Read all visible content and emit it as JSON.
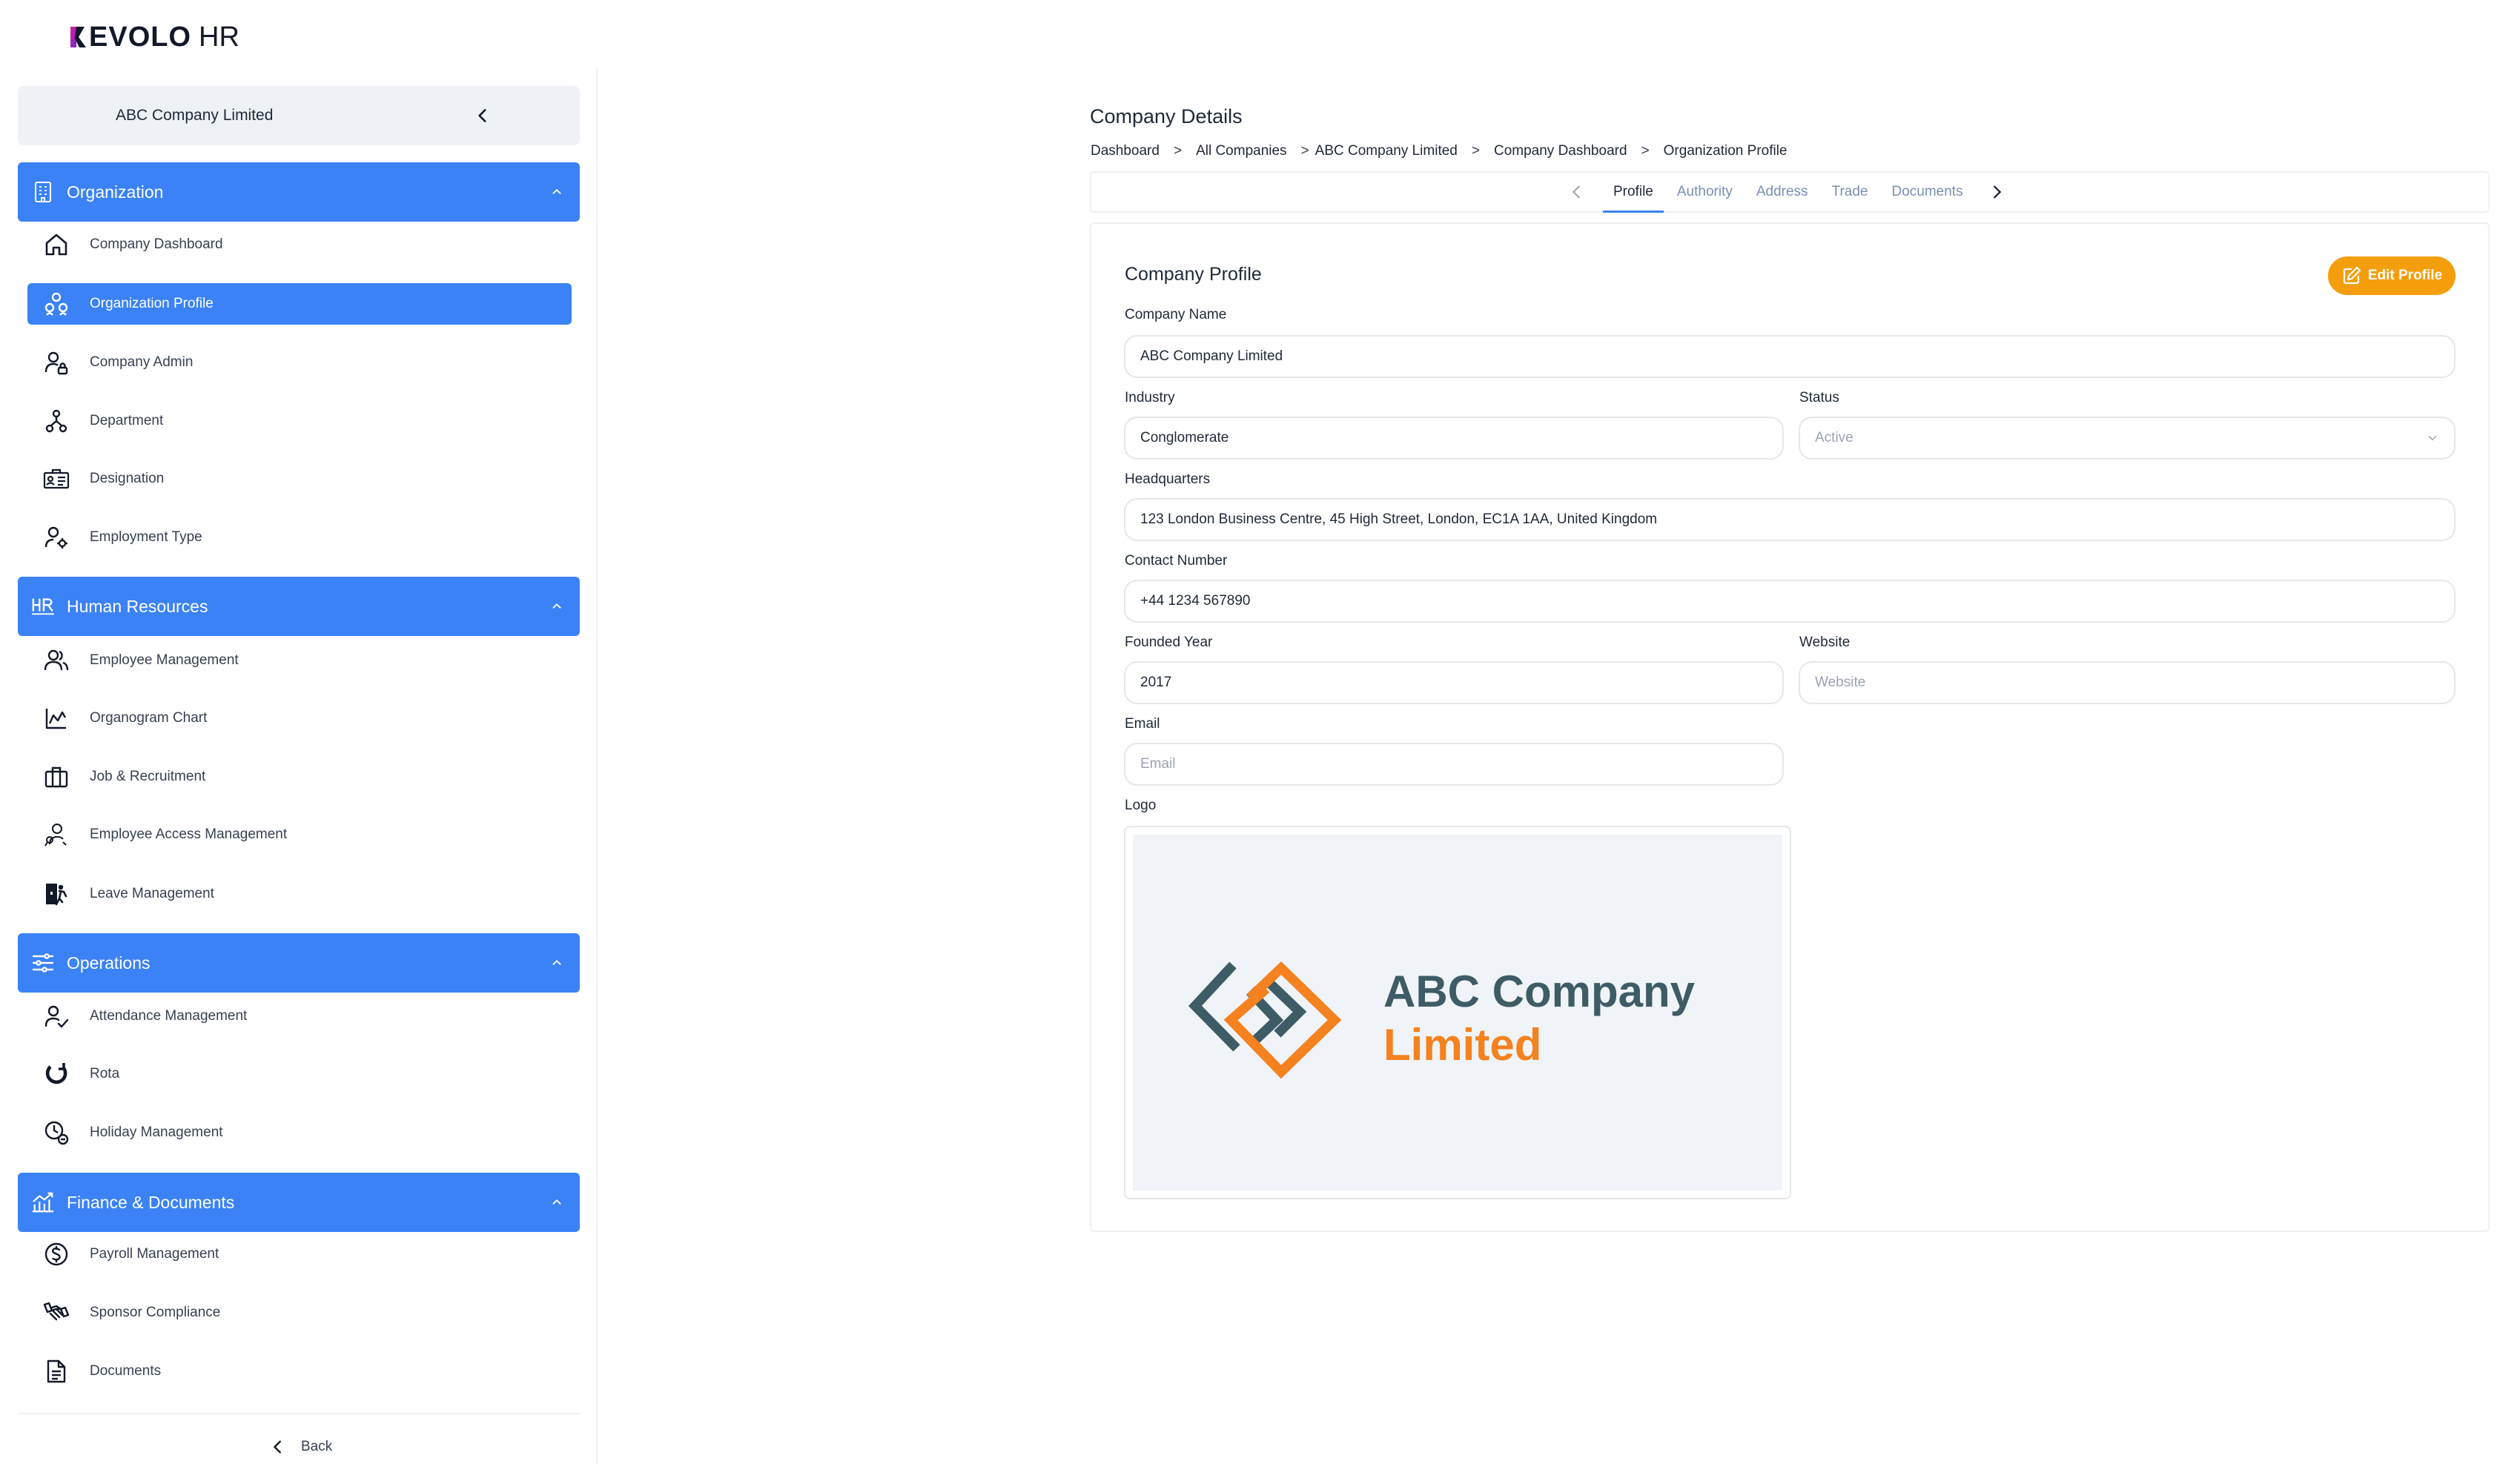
{
  "brand": {
    "name": "EVOLO",
    "suffix": "HR"
  },
  "sidebar": {
    "company_name": "ABC Company Limited",
    "sections": [
      {
        "label": "Organization",
        "items": [
          {
            "label": "Company Dashboard",
            "icon": "home-icon"
          },
          {
            "label": "Organization Profile",
            "icon": "organization-icon",
            "active": true
          },
          {
            "label": "Company Admin",
            "icon": "user-lock-icon"
          },
          {
            "label": "Department",
            "icon": "hierarchy-icon"
          },
          {
            "label": "Designation",
            "icon": "id-card-icon"
          },
          {
            "label": "Employment Type",
            "icon": "user-settings-icon"
          }
        ]
      },
      {
        "label": "Human Resources",
        "items": [
          {
            "label": "Employee Management",
            "icon": "users-icon"
          },
          {
            "label": "Organogram Chart",
            "icon": "chart-icon"
          },
          {
            "label": "Job & Recruitment",
            "icon": "briefcase-icon"
          },
          {
            "label": "Employee Access Management",
            "icon": "user-key-icon"
          },
          {
            "label": "Leave Management",
            "icon": "exit-icon"
          }
        ]
      },
      {
        "label": "Operations",
        "items": [
          {
            "label": "Attendance Management",
            "icon": "user-check-icon"
          },
          {
            "label": "Rota",
            "icon": "rota-icon"
          },
          {
            "label": "Holiday Management",
            "icon": "calendar-clock-icon"
          }
        ]
      },
      {
        "label": "Finance & Documents",
        "items": [
          {
            "label": "Payroll Management",
            "icon": "dollar-circle-icon"
          },
          {
            "label": "Sponsor Compliance",
            "icon": "handshake-icon"
          },
          {
            "label": "Documents",
            "icon": "document-icon"
          }
        ]
      }
    ],
    "back_label": "Back"
  },
  "main": {
    "page_title": "Company Details",
    "breadcrumb": [
      "Dashboard",
      "All Companies",
      "ABC Company Limited",
      "Company Dashboard",
      "Organization Profile"
    ],
    "breadcrumb_separator": ">",
    "tabs": [
      {
        "label": "Profile",
        "active": true
      },
      {
        "label": "Authority"
      },
      {
        "label": "Address"
      },
      {
        "label": "Trade"
      },
      {
        "label": "Documents"
      }
    ],
    "card_title": "Company Profile",
    "edit_label": "Edit Profile",
    "fields": {
      "company_name": {
        "label": "Company Name",
        "value": "ABC Company Limited"
      },
      "industry": {
        "label": "Industry",
        "value": "Conglomerate"
      },
      "status": {
        "label": "Status",
        "value": "Active"
      },
      "headquarters": {
        "label": "Headquarters",
        "value": "123 London Business Centre, 45 High Street, London, EC1A 1AA, United Kingdom"
      },
      "contact_number": {
        "label": "Contact Number",
        "value": "+44 1234 567890"
      },
      "founded_year": {
        "label": "Founded Year",
        "value": "2017"
      },
      "website": {
        "label": "Website",
        "placeholder": "Website"
      },
      "email": {
        "label": "Email",
        "placeholder": "Email"
      },
      "logo": {
        "label": "Logo"
      }
    },
    "logo_text": {
      "line1": "ABC Company",
      "line2": "Limited"
    }
  },
  "colors": {
    "primary": "#3b82f6",
    "accent": "#f59e0b",
    "logo_teal": "#3d5c65",
    "logo_orange": "#f5821f",
    "tab_inactive": "#7a8fb5"
  }
}
